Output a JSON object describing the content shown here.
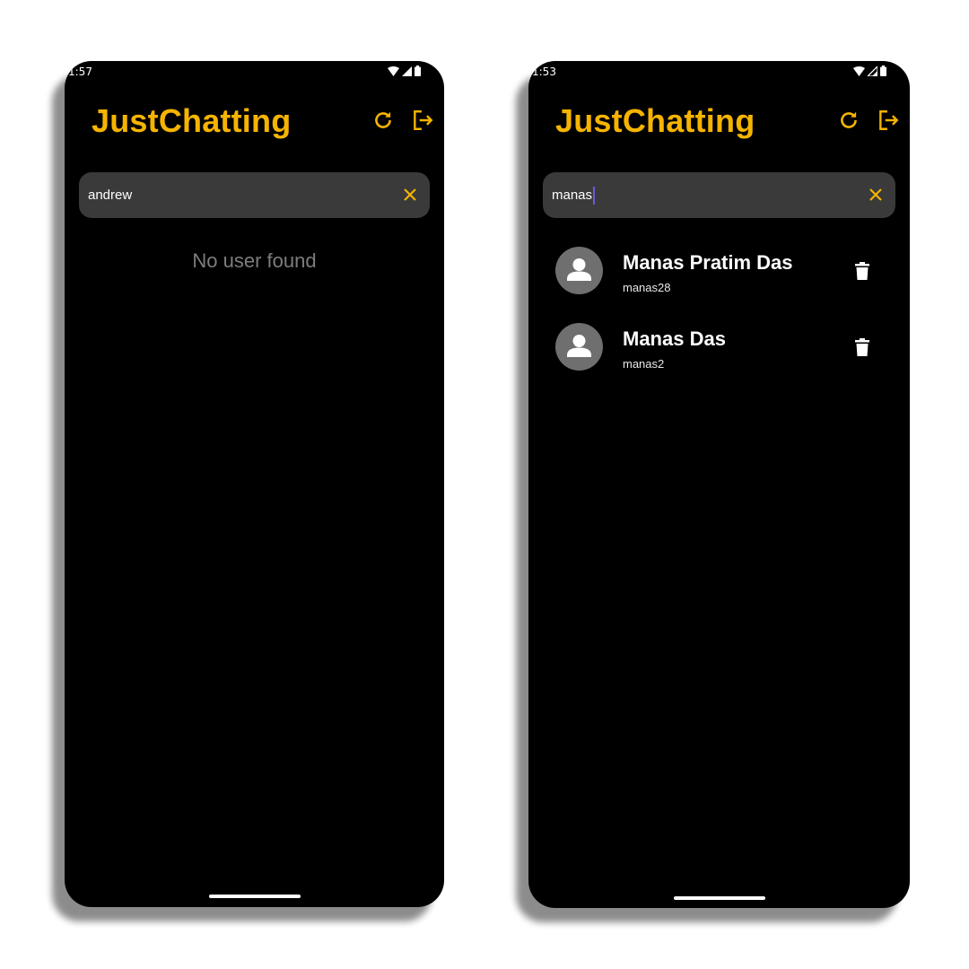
{
  "colors": {
    "accent": "#f5b400",
    "background": "#000000",
    "search_bg": "#3a3a3a",
    "muted": "#7d7d7d"
  },
  "left": {
    "status_time": "1:57",
    "app_title": "JustChatting",
    "search": {
      "value": "andrew",
      "clear_icon": "close-icon"
    },
    "top_icons": [
      "refresh-icon",
      "logout-icon"
    ],
    "empty_message": "No user found"
  },
  "right": {
    "status_time": "1:53",
    "app_title": "JustChatting",
    "search": {
      "value": "manas",
      "clear_icon": "close-icon"
    },
    "top_icons": [
      "refresh-icon",
      "logout-icon"
    ],
    "users": [
      {
        "name": "Manas Pratim Das",
        "username": "manas28"
      },
      {
        "name": "Manas Das",
        "username": "manas2"
      }
    ]
  }
}
